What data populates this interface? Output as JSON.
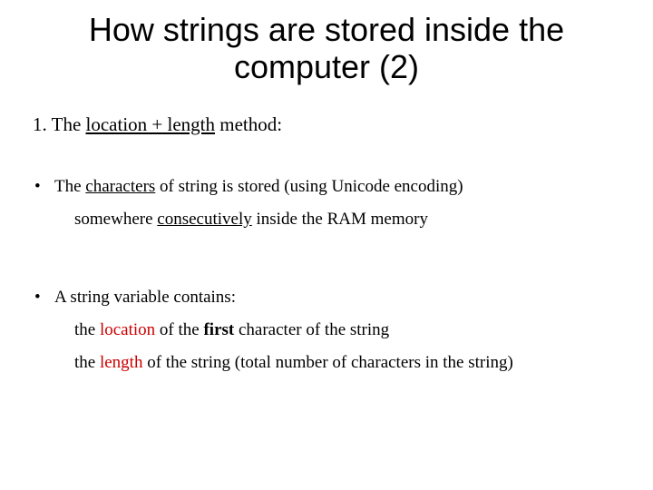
{
  "title": "How strings are stored inside the computer (2)",
  "numbered": {
    "num": "1.  ",
    "pre": "The ",
    "underlined": "location + length",
    "post": " method:"
  },
  "bullet1": {
    "line1": {
      "pre": "The ",
      "underlined": "characters",
      "post": " of string is stored (using Unicode encoding)"
    },
    "line2": {
      "pre": "somewhere ",
      "underlined": "consecutively",
      "post": " inside the RAM memory"
    }
  },
  "bullet2": {
    "line1": "A string variable contains:",
    "line2": {
      "pre": "the ",
      "red": "location",
      "mid": " of the ",
      "bold": "first",
      "post": " character of the string"
    },
    "line3": {
      "pre": "the ",
      "red": "length",
      "post": " of the string (total number of characters in the string)"
    }
  }
}
